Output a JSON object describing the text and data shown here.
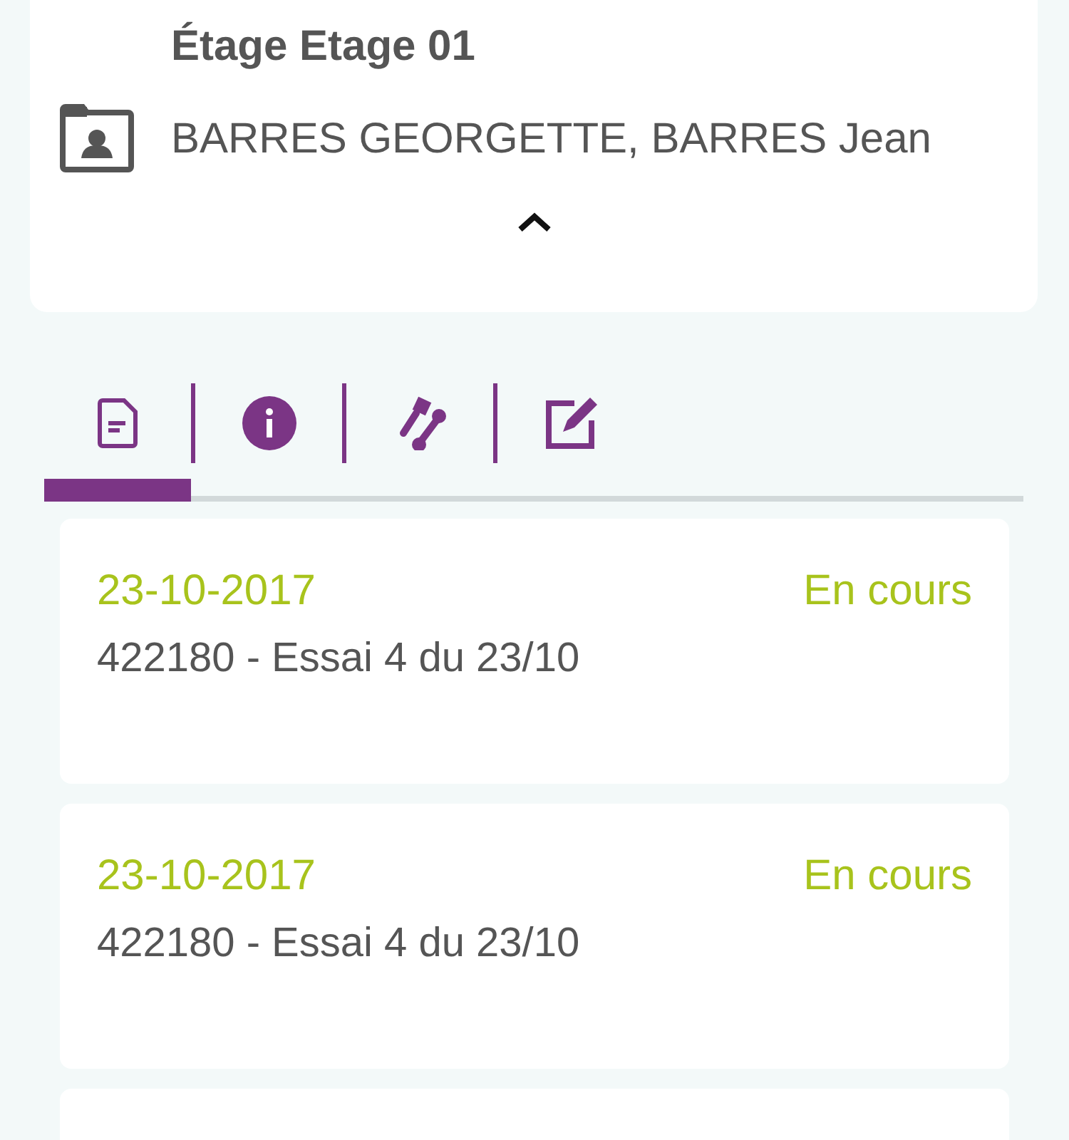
{
  "header": {
    "title": "Étage Etage 01",
    "occupants": "BARRES GEORGETTE, BARRES Jean"
  },
  "tabs": [
    {
      "kind": "document",
      "selected": true
    },
    {
      "kind": "info",
      "selected": false
    },
    {
      "kind": "tools",
      "selected": false
    },
    {
      "kind": "edit",
      "selected": false
    }
  ],
  "items": [
    {
      "date": "23-10-2017",
      "status": "En cours",
      "description": "422180 - Essai 4 du 23/10"
    },
    {
      "date": "23-10-2017",
      "status": "En cours",
      "description": "422180 - Essai 4 du 23/10"
    }
  ]
}
